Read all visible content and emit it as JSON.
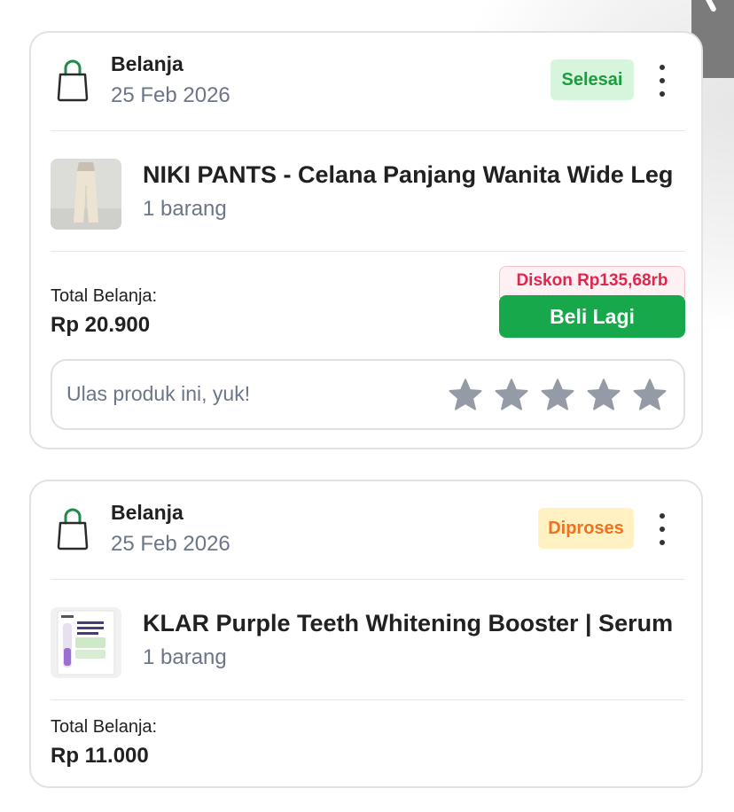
{
  "orders": [
    {
      "category": "Belanja",
      "date": "25 Feb 2026",
      "status": "Selesai",
      "product_name": "NIKI PANTS - Celana Panjang Wanita Wide Leg",
      "quantity": "1 barang",
      "total_label": "Total Belanja:",
      "total_price": "Rp 20.900",
      "discount": "Diskon Rp135,68rb",
      "buy_again_label": "Beli Lagi",
      "review_prompt": "Ulas produk ini, yuk!",
      "rating_stars": 5
    },
    {
      "category": "Belanja",
      "date": "25 Feb 2026",
      "status": "Diproses",
      "product_name": "KLAR Purple Teeth Whitening Booster | Serum",
      "quantity": "1 barang",
      "total_label": "Total Belanja:",
      "total_price": "Rp 11.000"
    }
  ],
  "colors": {
    "brand_green": "#16a84a",
    "status_done_bg": "#d6f5dd",
    "status_done_text": "#1c9b3f",
    "status_processing_bg": "#fff1c2",
    "status_processing_text": "#f0711e",
    "discount_text": "#e0264f",
    "star_gray": "#959ba6"
  },
  "icons": {
    "category": "shopping-bag-icon",
    "menu": "more-vertical-icon",
    "rating": "star-icon"
  }
}
